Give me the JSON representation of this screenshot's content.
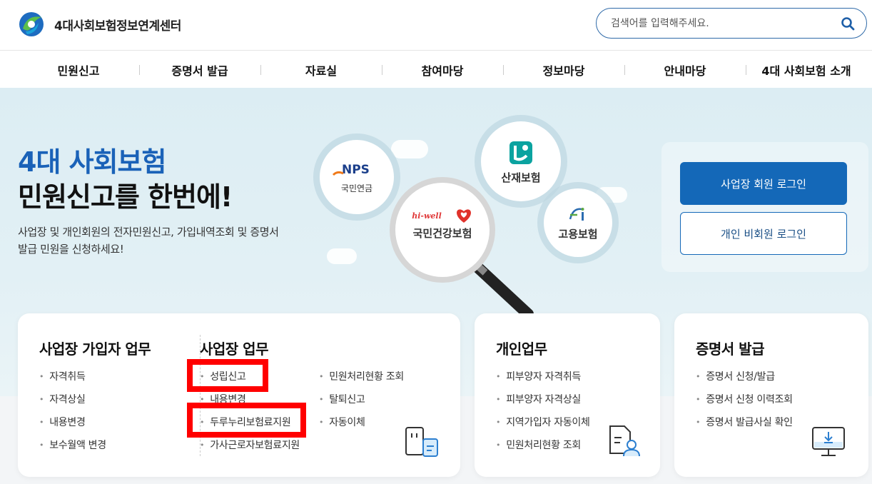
{
  "header": {
    "logo_text": "4대사회보험정보연계센터",
    "search_placeholder": "검색어를 입력해주세요."
  },
  "nav": {
    "items": [
      "민원신고",
      "증명서 발급",
      "자료실",
      "참여마당",
      "정보마당",
      "안내마당",
      "4대 사회보험 소개"
    ]
  },
  "hero": {
    "title_line1": "4대 사회보험",
    "title_line2": "민원신고를 한번에!",
    "description": "사업장 및 개인회원의 전자민원신고, 가입내역조회 및 증명서 발급 민원을 신청하세요!",
    "circles": {
      "nps_logo": "NPS",
      "nps_label": "국민연금",
      "comwel_label": "산재보험",
      "ei_label": "고용보험",
      "nhis_brand": "hi-well",
      "nhis_label": "국민건강보험"
    }
  },
  "login": {
    "member_button": "사업장 회원 로그인",
    "guest_button": "개인 비회원 로그인"
  },
  "cards": {
    "employer_join": {
      "title": "사업장 가입자 업무",
      "items": [
        "자격취득",
        "자격상실",
        "내용변경",
        "보수월액 변경"
      ]
    },
    "workplace": {
      "title": "사업장 업무",
      "col1": [
        "성립신고",
        "내용변경",
        "두루누리보험료지원",
        "가사근로자보험료지원"
      ],
      "col2": [
        "민원처리현황 조회",
        "탈퇴신고",
        "자동이체"
      ]
    },
    "personal": {
      "title": "개인업무",
      "items": [
        "피부양자 자격취득",
        "피부양자 자격상실",
        "지역가입자 자동이체",
        "민원처리현황 조회"
      ]
    },
    "certificate": {
      "title": "증명서 발급",
      "items": [
        "증명서 신청/발급",
        "증명서 신청 이력조회",
        "증명서 발급사실 확인"
      ]
    }
  },
  "colors": {
    "brand_blue": "#1468b8",
    "title_blue": "#1a62b8",
    "highlight_red": "#ff0000"
  }
}
